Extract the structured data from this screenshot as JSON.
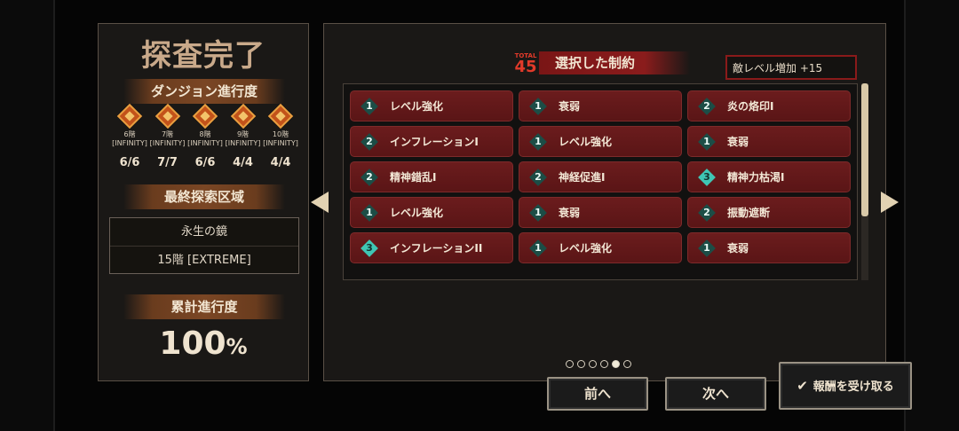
{
  "title": "探査完了",
  "progress_section": {
    "heading": "ダンジョン進行度",
    "floors": [
      {
        "floor": "6階",
        "mode": "INFINITY",
        "count": "6/6"
      },
      {
        "floor": "7階",
        "mode": "INFINITY",
        "count": "7/7"
      },
      {
        "floor": "8階",
        "mode": "INFINITY",
        "count": "6/6"
      },
      {
        "floor": "9階",
        "mode": "INFINITY",
        "count": "4/4"
      },
      {
        "floor": "10階",
        "mode": "INFINITY",
        "count": "4/4"
      }
    ]
  },
  "final_area": {
    "heading": "最終探索区域",
    "name": "永生の鏡",
    "floor": "15階 [EXTREME]"
  },
  "cumulative": {
    "heading": "累計進行度",
    "value": "100",
    "unit": "%"
  },
  "constraints": {
    "total_label": "TOTAL",
    "total_value": "45",
    "title": "選択した制約",
    "enemy_level": "敵レベル増加 +15",
    "items": [
      {
        "level": "1",
        "name": "レベル強化"
      },
      {
        "level": "1",
        "name": "衰弱"
      },
      {
        "level": "2",
        "name": "炎の烙印I"
      },
      {
        "level": "2",
        "name": "インフレーションI"
      },
      {
        "level": "1",
        "name": "レベル強化"
      },
      {
        "level": "1",
        "name": "衰弱"
      },
      {
        "level": "2",
        "name": "精神錯乱I"
      },
      {
        "level": "2",
        "name": "神経促進I"
      },
      {
        "level": "3",
        "name": "精神力枯渇I"
      },
      {
        "level": "1",
        "name": "レベル強化"
      },
      {
        "level": "1",
        "name": "衰弱"
      },
      {
        "level": "2",
        "name": "振動遮断"
      },
      {
        "level": "3",
        "name": "インフレーションII"
      },
      {
        "level": "1",
        "name": "レベル強化"
      },
      {
        "level": "1",
        "name": "衰弱"
      }
    ]
  },
  "pagination": {
    "total": 6,
    "active": 5
  },
  "buttons": {
    "prev": "前へ",
    "next": "次へ",
    "claim": "報酬を受け取る"
  },
  "icons": {
    "check": "✔",
    "arrow_left": "triangle-left",
    "arrow_right": "triangle-right"
  }
}
